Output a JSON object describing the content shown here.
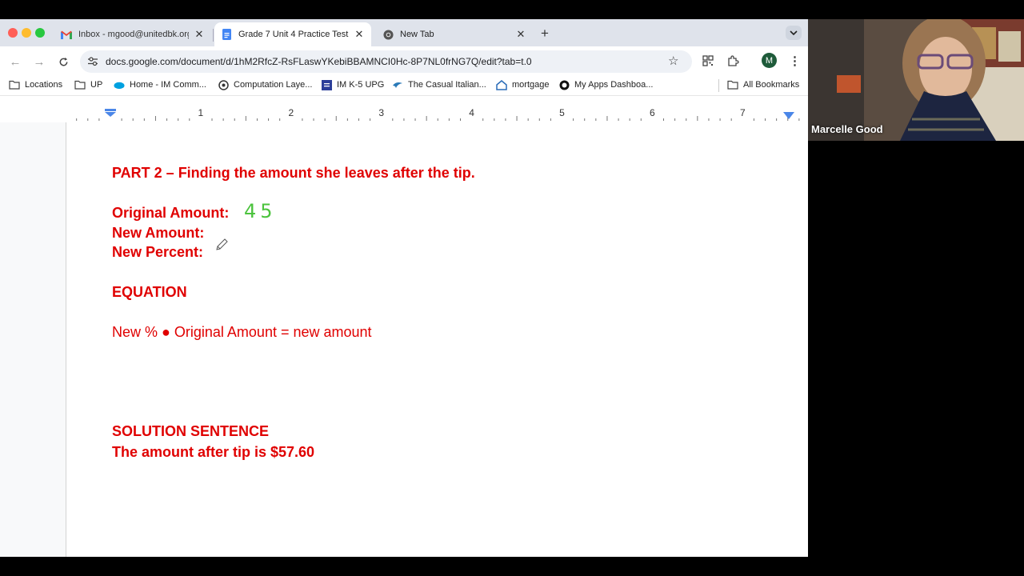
{
  "tabs": [
    {
      "title": "Inbox - mgood@unitedbk.org",
      "icon": "gmail-icon"
    },
    {
      "title": "Grade 7 Unit 4 Practice Test",
      "icon": "google-docs-icon"
    },
    {
      "title": "New Tab",
      "icon": "chrome-icon"
    }
  ],
  "address_bar": {
    "url": "docs.google.com/document/d/1hM2RfcZ-RsFLaswYKebiBBAMNCI0Hc-8P7NL0frNG7Q/edit?tab=t.0"
  },
  "profile": {
    "initial": "M"
  },
  "bookmarks": [
    {
      "label": "Locations",
      "icon": "folder-icon"
    },
    {
      "label": "UP",
      "icon": "folder-icon"
    },
    {
      "label": "Home - IM Comm...",
      "icon": "salesforce-cloud-icon"
    },
    {
      "label": "Computation Laye...",
      "icon": "compass-icon"
    },
    {
      "label": "IM K-5 UPG",
      "icon": "im-icon"
    },
    {
      "label": "The Casual Italian...",
      "icon": "bird-icon"
    },
    {
      "label": "mortgage",
      "icon": "house-icon"
    },
    {
      "label": "My Apps Dashboa...",
      "icon": "okta-icon"
    }
  ],
  "all_bookmarks": "All Bookmarks",
  "ruler": {
    "numbers": [
      "1",
      "2",
      "3",
      "4",
      "5",
      "6",
      "7"
    ]
  },
  "document": {
    "part_heading": "PART 2 – Finding the amount she leaves after the tip.",
    "original_amount_label": "Original Amount:",
    "original_amount_value": "45",
    "new_amount_label": "New Amount:",
    "new_percent_label": "New Percent:",
    "equation_heading": "EQUATION",
    "equation": "New % ● Original Amount = new amount",
    "solution_heading": "SOLUTION SENTENCE",
    "solution": "The amount after tip is $57.60"
  },
  "webcam": {
    "name": "Marcelle Good"
  },
  "colors": {
    "doc_red": "#e00000",
    "handwriting_green": "#4cc33e"
  }
}
